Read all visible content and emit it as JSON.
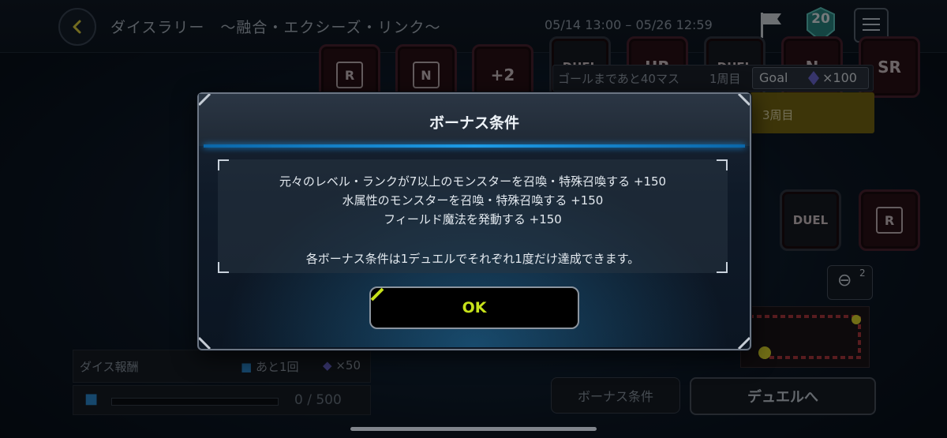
{
  "header": {
    "title": "ダイスラリー　～融合・エクシーズ・リンク～",
    "period": "05/14 13:00 – 05/26 12:59",
    "level": "20"
  },
  "board": {
    "tiles_top": [
      "R",
      "N",
      "+2",
      "DUEL",
      "UR",
      "DUEL",
      "N",
      "SR"
    ],
    "tiles_mid": [
      "DUEL",
      "R"
    ],
    "goal_rest": "ゴールまであと40マス",
    "lap1": "1周目",
    "goal_label": "Goal",
    "goal_reward": "×100",
    "lap3": "3周目",
    "zoom_level": "2"
  },
  "dice_reward": {
    "label": "ダイス報酬",
    "remaining": "あと1回",
    "reward": "×50",
    "progress_text": "0 / 500",
    "progress_fraction": 0
  },
  "buttons": {
    "bonus": "ボーナス条件",
    "duel": "デュエルへ"
  },
  "dialog": {
    "title": "ボーナス条件",
    "conditions": [
      "元々のレベル・ランクが7以上のモンスターを召喚・特殊召喚する +150",
      "水属性のモンスターを召喚・特殊召喚する +150",
      "フィールド魔法を発動する +150"
    ],
    "note": "各ボーナス条件は1デュエルでそれぞれ1度だけ達成できます。",
    "ok": "OK"
  },
  "colors": {
    "accent": "#c7e21a",
    "rule_blue": "#1d9be6"
  },
  "icons": [
    "back-icon",
    "flag-icon",
    "level-badge-icon",
    "menu-icon",
    "gem-icon",
    "dice-icon",
    "zoom-out-icon"
  ]
}
